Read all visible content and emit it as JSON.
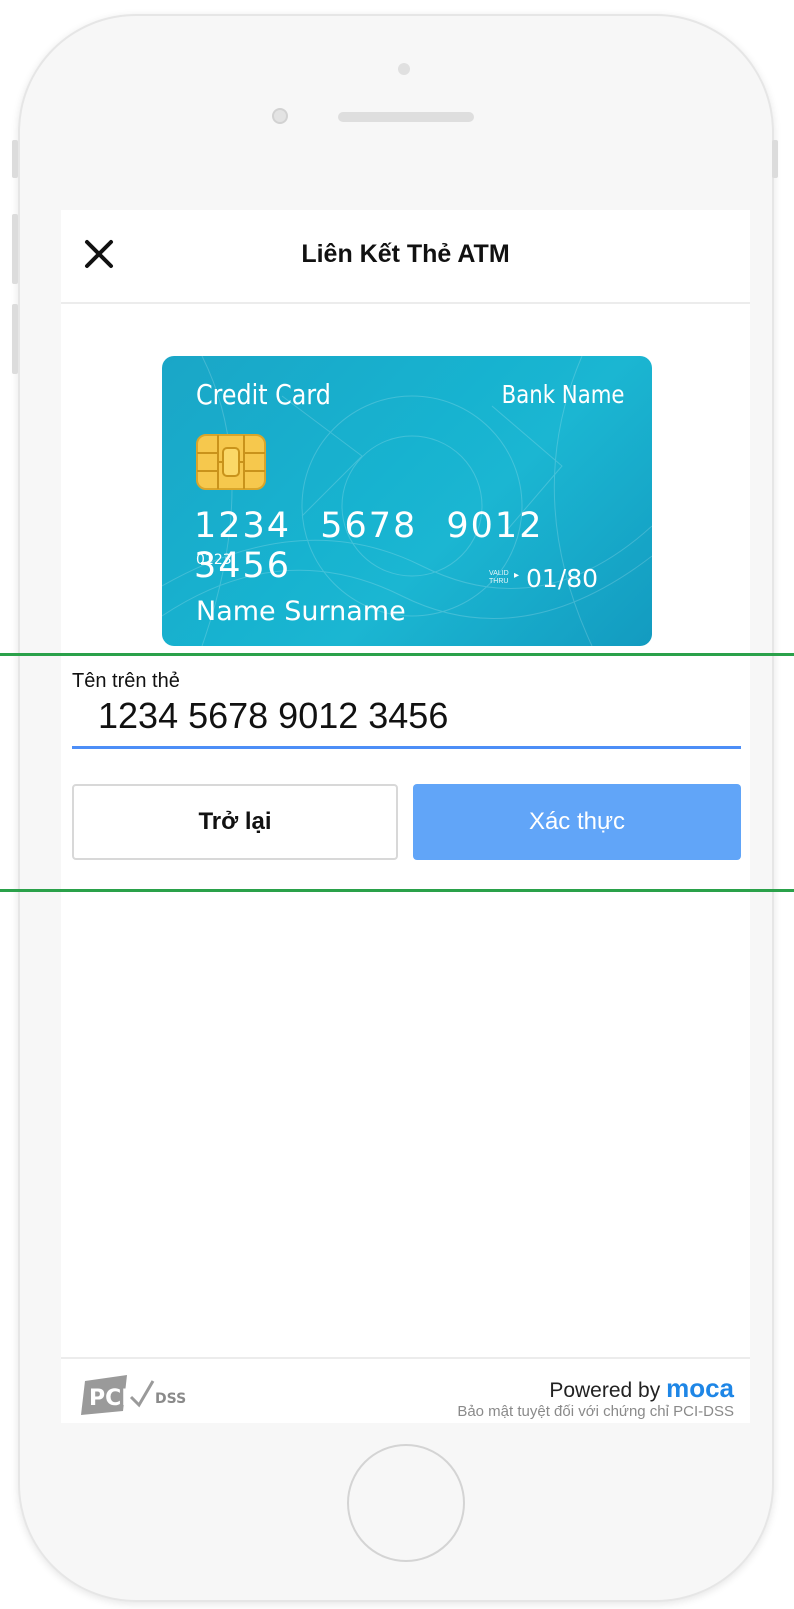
{
  "header": {
    "title": "Liên Kết Thẻ ATM",
    "close_icon": "close-icon"
  },
  "card_preview": {
    "type_label": "Credit Card",
    "bank_label": "Bank Name",
    "number": "1234 5678 9012 3456",
    "small_number": "0123",
    "valid_thru_line1": "VALID",
    "valid_thru_line2": "THRU",
    "expiry": "01/80",
    "holder_name": "Name Surname",
    "color": "#1aa6c7",
    "chip_icon": "chip-icon"
  },
  "form": {
    "field_label": "Tên trên thẻ",
    "field_value": "1234 5678 9012 3456",
    "underline_color": "#4d8ef7",
    "back_label": "Trở lại",
    "verify_label": "Xác thực",
    "verify_color": "#61a5f8"
  },
  "footer": {
    "pci_logo_text": "PCI DSS",
    "powered_prefix": "Powered by",
    "powered_brand": "moca",
    "security_note": "Bảo mật tuyệt đối với chứng chỉ PCI-DSS",
    "brand_color": "#1e86e6"
  },
  "guide_color": "#2aa14a"
}
